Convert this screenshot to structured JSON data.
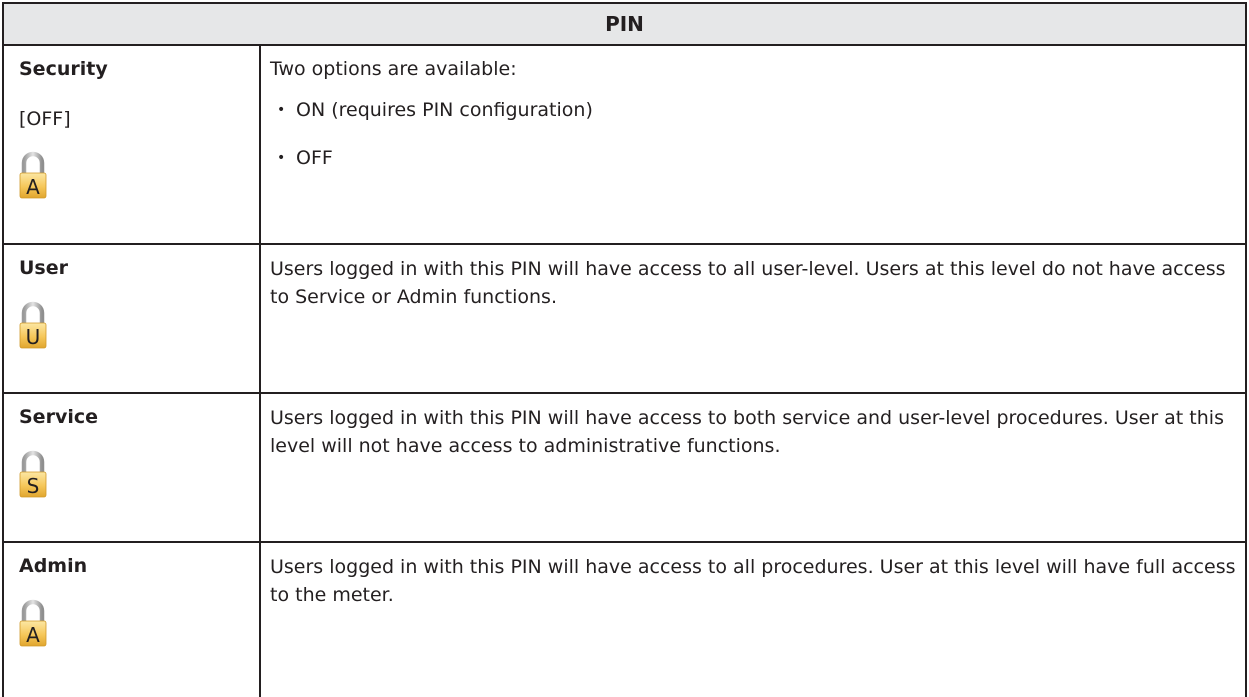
{
  "table": {
    "header": "PIN",
    "rows": [
      {
        "title": "Security",
        "value": "[OFF]",
        "icon": "padlock-icon",
        "icon_letter": "A",
        "intro": "Two options are available:",
        "options": [
          "ON (requires PIN configuration)",
          "OFF"
        ],
        "bullet": "•"
      },
      {
        "title": "User",
        "icon": "padlock-icon",
        "icon_letter": "U",
        "description": "Users logged in with this PIN will have access to all user-level. Users at this level do not have access to Service or Admin functions."
      },
      {
        "title": "Service",
        "icon": "padlock-icon",
        "icon_letter": "S",
        "description": "Users logged in with this PIN will have access to both service and user-level procedures. User at this level will not have access to administrative functions."
      },
      {
        "title": "Admin",
        "icon": "padlock-icon",
        "icon_letter": "A",
        "description": "Users logged in with this PIN will have access to all procedures. User at this level will have full access to the meter."
      }
    ]
  },
  "colors": {
    "border": "#231f20",
    "header_bg": "#e6e7e8",
    "lock_body": "#f6c75a",
    "lock_shackle": "#c9c9c9"
  }
}
